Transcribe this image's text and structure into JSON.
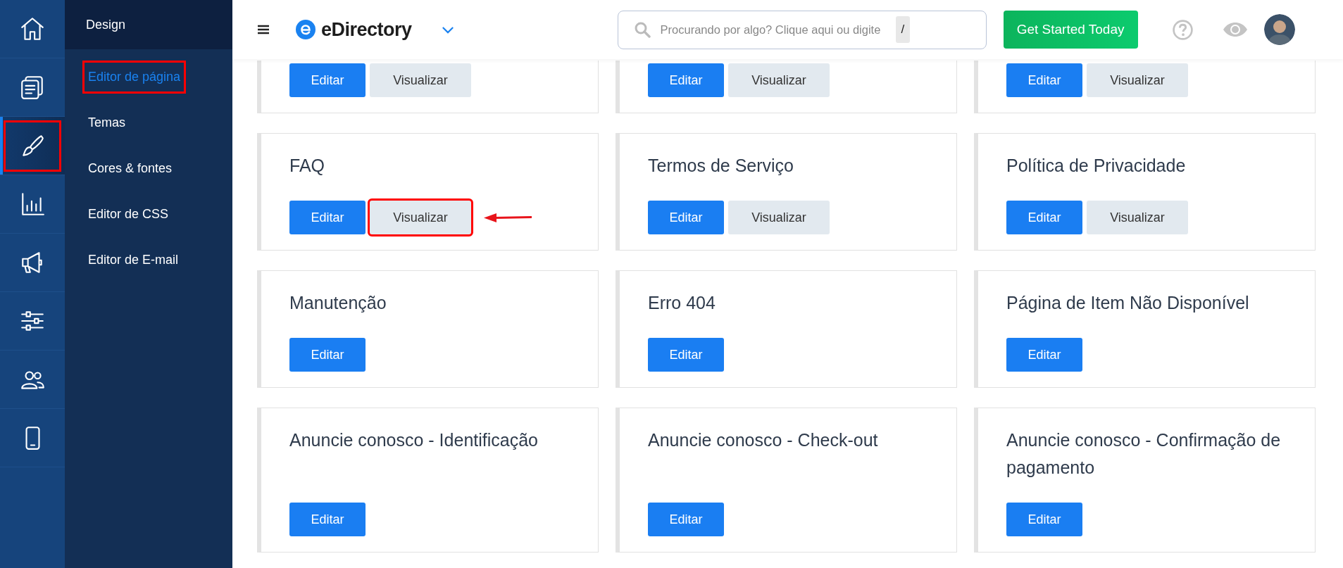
{
  "rail": [
    {
      "selected": false,
      "highlighted": false
    },
    {
      "selected": false,
      "highlighted": false
    },
    {
      "selected": true,
      "highlighted": true
    },
    {
      "selected": false,
      "highlighted": false
    },
    {
      "selected": false,
      "highlighted": false
    },
    {
      "selected": false,
      "highlighted": false
    },
    {
      "selected": false,
      "highlighted": false
    },
    {
      "selected": false,
      "highlighted": false
    }
  ],
  "submenu": {
    "title": "Design",
    "items": [
      {
        "label": "Editor de página",
        "selected": true,
        "highlighted": true
      },
      {
        "label": "Temas",
        "selected": false,
        "highlighted": false
      },
      {
        "label": "Cores & fontes",
        "selected": false,
        "highlighted": false
      },
      {
        "label": "Editor de CSS",
        "selected": false,
        "highlighted": false
      },
      {
        "label": "Editor de E-mail",
        "selected": false,
        "highlighted": false
      }
    ]
  },
  "header": {
    "logo": "eDirectory",
    "search": {
      "placeholder": "Procurando por algo? Clique aqui ou digite",
      "shortcut": "/"
    },
    "cta": "Get Started Today"
  },
  "cards": [
    {
      "buttons": [
        {
          "label": "Editar",
          "kind": "primary",
          "highlighted": false
        },
        {
          "label": "Visualizar",
          "kind": "secondary",
          "highlighted": false
        }
      ]
    },
    {
      "buttons": [
        {
          "label": "Editar",
          "kind": "primary",
          "highlighted": false
        },
        {
          "label": "Visualizar",
          "kind": "secondary",
          "highlighted": false
        }
      ]
    },
    {
      "buttons": [
        {
          "label": "Editar",
          "kind": "primary",
          "highlighted": false
        },
        {
          "label": "Visualizar",
          "kind": "secondary",
          "highlighted": false
        }
      ]
    },
    {
      "title": "FAQ",
      "buttons": [
        {
          "label": "Editar",
          "kind": "primary",
          "highlighted": false
        },
        {
          "label": "Visualizar",
          "kind": "secondary",
          "highlighted": true,
          "arrow": true
        }
      ]
    },
    {
      "title": "Termos de Serviço",
      "buttons": [
        {
          "label": "Editar",
          "kind": "primary",
          "highlighted": false
        },
        {
          "label": "Visualizar",
          "kind": "secondary",
          "highlighted": false
        }
      ]
    },
    {
      "title": "Política de Privacidade",
      "buttons": [
        {
          "label": "Editar",
          "kind": "primary",
          "highlighted": false
        },
        {
          "label": "Visualizar",
          "kind": "secondary",
          "highlighted": false
        }
      ]
    },
    {
      "title": "Manutenção",
      "buttons": [
        {
          "label": "Editar",
          "kind": "primary",
          "highlighted": false
        }
      ]
    },
    {
      "title": "Erro 404",
      "buttons": [
        {
          "label": "Editar",
          "kind": "primary",
          "highlighted": false
        }
      ]
    },
    {
      "title": "Página de Item Não Disponível",
      "buttons": [
        {
          "label": "Editar",
          "kind": "primary",
          "highlighted": false
        }
      ]
    },
    {
      "title": "Anuncie conosco - Identificação",
      "buttons": [
        {
          "label": "Editar",
          "kind": "primary",
          "highlighted": false
        }
      ]
    },
    {
      "title": "Anuncie conosco - Check-out",
      "buttons": [
        {
          "label": "Editar",
          "kind": "primary",
          "highlighted": false
        }
      ]
    },
    {
      "title": "Anuncie conosco - Confirmação de pagamento",
      "buttons": [
        {
          "label": "Editar",
          "kind": "primary",
          "highlighted": false
        }
      ]
    }
  ]
}
